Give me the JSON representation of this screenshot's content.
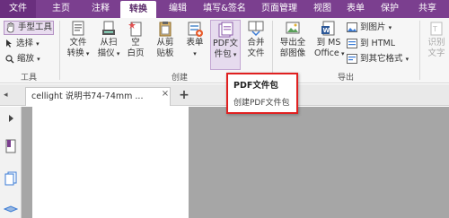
{
  "menubar": {
    "items": [
      "文件",
      "主页",
      "注释",
      "转换",
      "编辑",
      "填写&签名",
      "页面管理",
      "视图",
      "表单",
      "保护",
      "共享"
    ],
    "active_index": 3
  },
  "ribbon": {
    "tools": {
      "hand": "手型工具",
      "select": "选择",
      "zoom": "缩放",
      "group_label": "工具"
    },
    "create": {
      "file_convert": [
        "文件",
        "转换"
      ],
      "scanner": [
        "从扫",
        "描仪"
      ],
      "blank": [
        "空",
        "白页"
      ],
      "clipboard": [
        "从剪",
        "贴板"
      ],
      "form": [
        "表单",
        ""
      ],
      "pdf_package": [
        "PDF文",
        "件包"
      ],
      "merge": [
        "合并",
        "文件"
      ],
      "group_label": "创建"
    },
    "export": {
      "export_all_images": [
        "导出全",
        "部图像"
      ],
      "to_ms_office": [
        "到 MS",
        "Office"
      ],
      "to_image": "到图片",
      "to_html": "到 HTML",
      "to_other": "到其它格式",
      "group_label": "导出"
    },
    "extra": {
      "recognize_text": [
        "识别",
        "文字"
      ]
    }
  },
  "tabs": {
    "document_tab": "cellight 说明书74-74mm ...",
    "close_glyph": "×",
    "add_glyph": "+"
  },
  "popup": {
    "title": "PDF文件包",
    "description": "创建PDF文件包"
  },
  "colors": {
    "menubar_bg": "#7b3f8f",
    "highlight_border": "#e02020",
    "canvas_bg": "#a6a6a6"
  }
}
